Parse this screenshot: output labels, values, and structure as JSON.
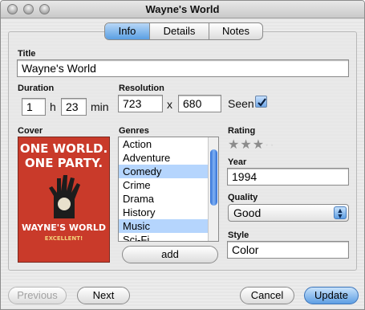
{
  "window": {
    "title": "Wayne's World"
  },
  "tabs": [
    {
      "label": "Info",
      "selected": true
    },
    {
      "label": "Details",
      "selected": false
    },
    {
      "label": "Notes",
      "selected": false
    }
  ],
  "form": {
    "title": {
      "label": "Title",
      "value": "Wayne's World"
    },
    "duration": {
      "label": "Duration",
      "hours": "1",
      "hours_unit": "h",
      "minutes": "23",
      "minutes_unit": "min"
    },
    "resolution": {
      "label": "Resolution",
      "width": "723",
      "separator": "x",
      "height": "680"
    },
    "seen": {
      "label": "Seen",
      "checked": true
    },
    "cover": {
      "label": "Cover",
      "poster_lines": [
        "ONE WORLD.",
        "ONE PARTY.",
        "WAYNE'S WORLD",
        "EXCELLENT!"
      ]
    },
    "genres": {
      "label": "Genres",
      "items": [
        {
          "label": "Action",
          "selected": false
        },
        {
          "label": "Adventure",
          "selected": false
        },
        {
          "label": "Comedy",
          "selected": true
        },
        {
          "label": "Crime",
          "selected": false
        },
        {
          "label": "Drama",
          "selected": false
        },
        {
          "label": "History",
          "selected": false
        },
        {
          "label": "Music",
          "selected": true
        },
        {
          "label": "Sci-Fi",
          "selected": false
        }
      ],
      "add_label": "add"
    },
    "rating": {
      "label": "Rating",
      "value": 3,
      "max": 5
    },
    "year": {
      "label": "Year",
      "value": "1994"
    },
    "quality": {
      "label": "Quality",
      "value": "Good"
    },
    "style": {
      "label": "Style",
      "value": "Color"
    }
  },
  "buttons": {
    "previous": "Previous",
    "next": "Next",
    "cancel": "Cancel",
    "update": "Update"
  }
}
